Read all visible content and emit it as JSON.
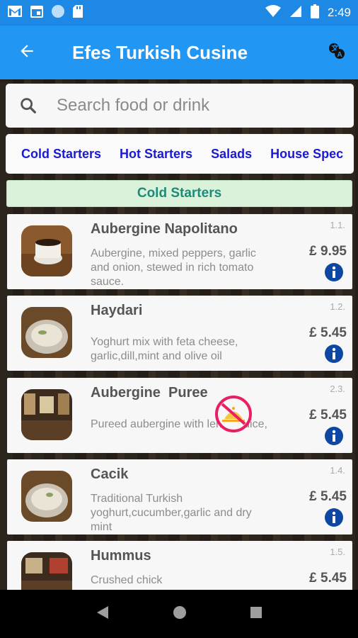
{
  "status_bar": {
    "time": "2:49",
    "left_icons": [
      "gmail-icon",
      "calendar-icon",
      "circle-icon",
      "sd-card-icon"
    ],
    "right_icons": [
      "wifi-icon",
      "signal-icon",
      "battery-icon"
    ]
  },
  "app_bar": {
    "title": "Efes Turkish Cusine",
    "back_icon": "arrow-back-icon",
    "action_icon": "translate-icon"
  },
  "search": {
    "placeholder": "Search food or drink"
  },
  "categories": [
    "Cold Starters",
    "Hot Starters",
    "Salads",
    "House Spec"
  ],
  "section": {
    "title": "Cold Starters"
  },
  "items": [
    {
      "name": "Aubergine Napolitano",
      "description": "Aubergine, mixed peppers, garlic and onion, stewed in rich tomato sauce.",
      "code": "1.1.",
      "price": "£ 9.95",
      "unavailable": false
    },
    {
      "name": "Haydari",
      "description": "Yoghurt mix with feta cheese, garlic,dill,mint and olive oil",
      "code": "1.2.",
      "price": "£ 5.45",
      "unavailable": false
    },
    {
      "name": "Aubergine  Puree",
      "description": "Pureed aubergine with lemon juice,olive,oil,yoghurt and garlic",
      "code": "2.3.",
      "price": "£ 5.45",
      "unavailable": true
    },
    {
      "name": "Cacik",
      "description": "Traditional Turkish yoghurt,cucumber,garlic and dry mint",
      "code": "1.4.",
      "price": "£ 5.45",
      "unavailable": false
    },
    {
      "name": "Hummus",
      "description": "Crushed chick",
      "code": "1.5.",
      "price": "£ 5.45",
      "unavailable": false
    }
  ],
  "nav_bar": {
    "icons": [
      "nav-back-icon",
      "nav-home-icon",
      "nav-recents-icon"
    ]
  },
  "colors": {
    "app_bar": "#2196f3",
    "status_bar": "#1e88e5",
    "category_text": "#1a1ad6",
    "section_bg": "#d9f2d9",
    "section_text": "#1e8a7a",
    "info_icon": "#0d47a1",
    "unavailable_badge": "#e91e63"
  }
}
